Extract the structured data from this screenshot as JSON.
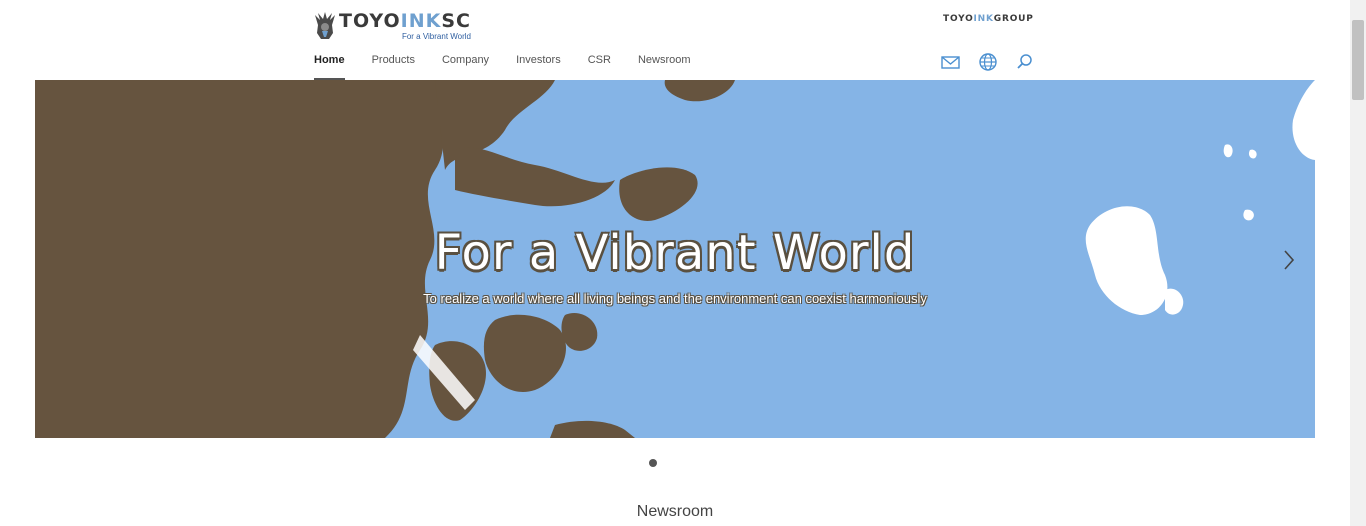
{
  "brand": {
    "name_part1": "TOYO",
    "name_part2": "INK",
    "name_part3": "SC",
    "tagline": "For a Vibrant World",
    "group_part1": "TOYO",
    "group_part2": "INK",
    "group_part3": "GROUP",
    "accent_color": "#6fa0cf"
  },
  "nav": {
    "items": [
      {
        "label": "Home",
        "active": true
      },
      {
        "label": "Products",
        "active": false
      },
      {
        "label": "Company",
        "active": false
      },
      {
        "label": "Investors",
        "active": false
      },
      {
        "label": "CSR",
        "active": false
      },
      {
        "label": "Newsroom",
        "active": false
      }
    ]
  },
  "header_icons": [
    "mail-icon",
    "globe-icon",
    "search-icon"
  ],
  "hero": {
    "title": "For a Vibrant World",
    "subtitle": "To realize a world where all living beings and the environment can coexist harmoniously",
    "sea_color": "#85b4e6",
    "land_color": "#66543f",
    "slide_index": 1,
    "slide_count": 1
  },
  "sections": {
    "newsroom_heading": "Newsroom"
  }
}
